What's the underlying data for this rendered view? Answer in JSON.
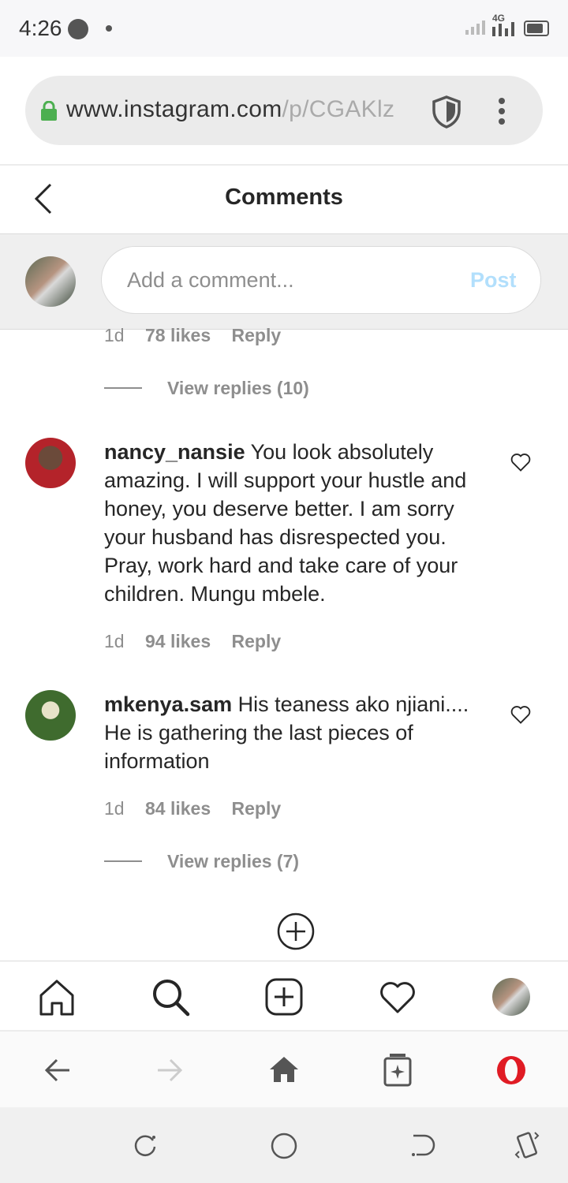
{
  "status_bar": {
    "time": "4:26",
    "network": "4G"
  },
  "browser": {
    "url_domain": "www.instagram.com",
    "url_path": "/p/CGAKlz",
    "icons": [
      "lock-icon",
      "shield-icon",
      "kebab-menu-icon"
    ]
  },
  "header": {
    "title": "Comments",
    "back_icon": "chevron-left-icon"
  },
  "composer": {
    "placeholder": "Add a comment...",
    "post_label": "Post"
  },
  "partial_comment": {
    "age": "1d",
    "likes": "78 likes",
    "reply": "Reply",
    "view_replies": "View replies (10)"
  },
  "comments": [
    {
      "username": "nancy_nansie",
      "text": "You look absolutely amazing. I will support your hustle and honey, you deserve better. I am sorry your husband has disrespected you. Pray, work hard and take care of your children. Mungu mbele.",
      "age": "1d",
      "likes": "94 likes",
      "reply": "Reply"
    },
    {
      "username": "mkenya.sam",
      "text": "His teaness ako njiani.... He is gathering the last pieces of information",
      "age": "1d",
      "likes": "84 likes",
      "reply": "Reply",
      "view_replies": "View replies (7)"
    }
  ],
  "load_more_icon": "plus-circle-icon",
  "app_nav": [
    "home-icon",
    "search-icon",
    "new-post-icon",
    "activity-heart-icon",
    "profile-avatar"
  ],
  "browser_nav": [
    "back-arrow-icon",
    "forward-arrow-icon",
    "home-icon",
    "tabs-icon",
    "opera-icon"
  ],
  "system_nav": [
    "recents-icon",
    "home-circle-icon",
    "back-icon",
    "rotate-icon"
  ],
  "colors": {
    "post_disabled": "#b2dffc",
    "secondary_text": "#8e8e8e",
    "opera_red": "#e01b24",
    "lock_green": "#4caf50"
  }
}
